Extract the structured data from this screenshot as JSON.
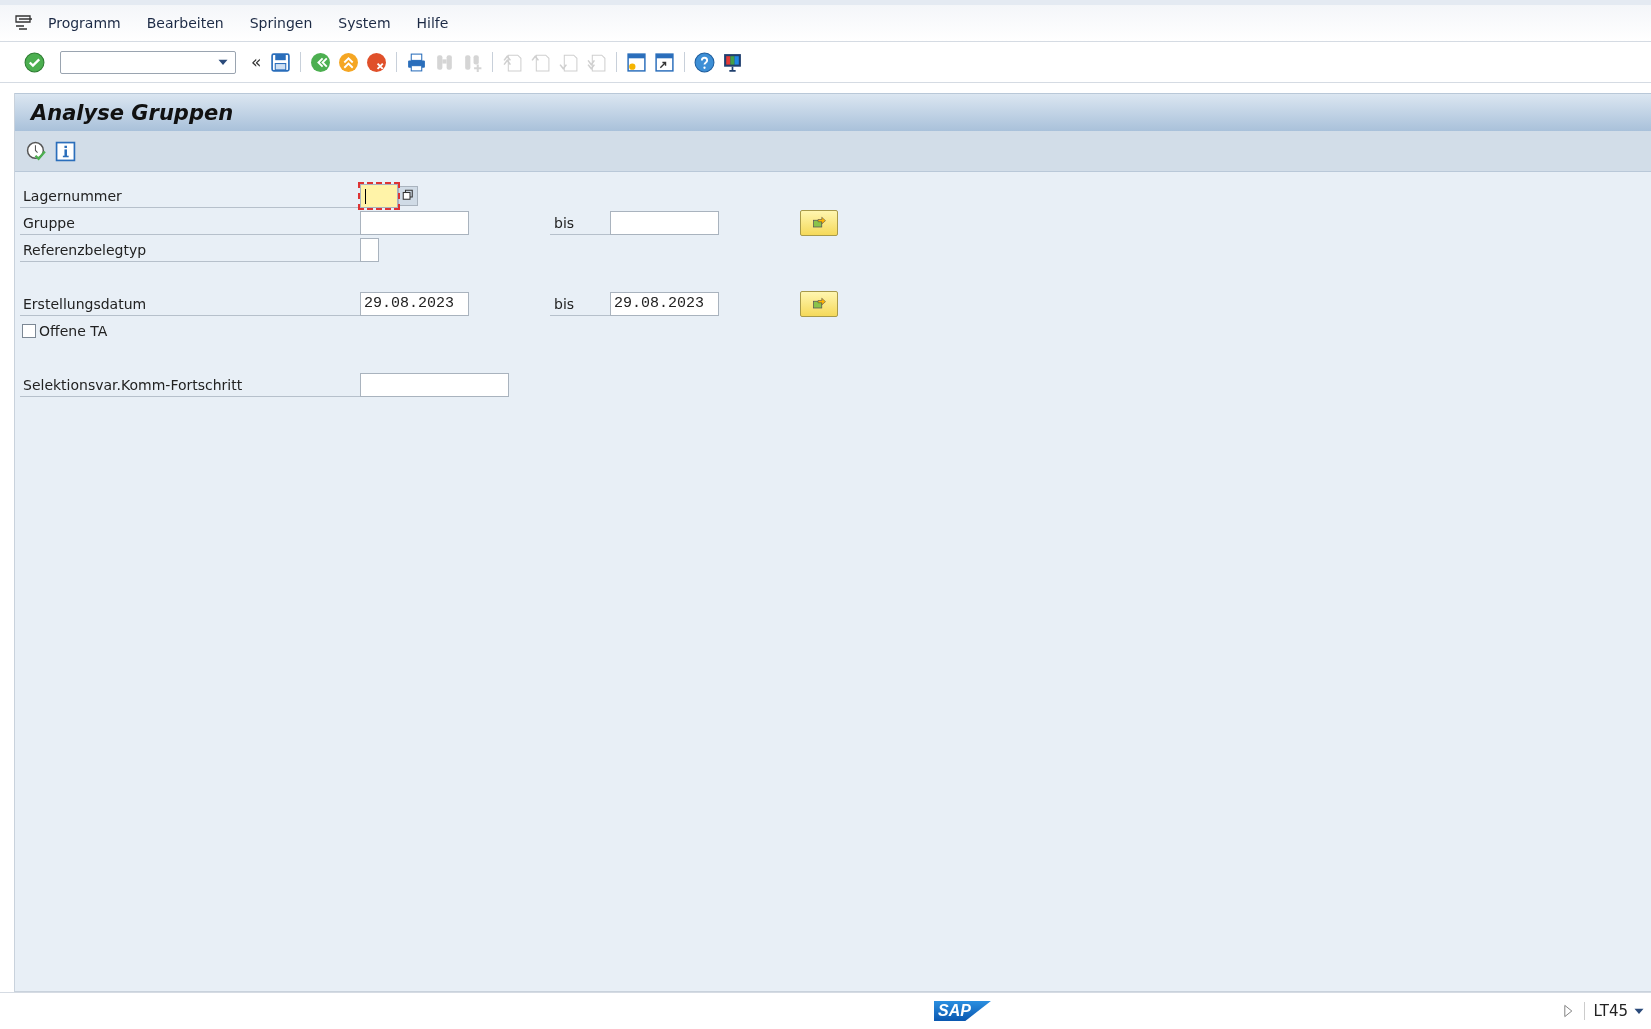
{
  "menu": [
    {
      "label": "Programm"
    },
    {
      "label": "Bearbeiten"
    },
    {
      "label": "Springen"
    },
    {
      "label": "System"
    },
    {
      "label": "Hilfe"
    }
  ],
  "toolbar": [
    {
      "kind": "enter",
      "disabled": false
    },
    {
      "kind": "command"
    },
    {
      "kind": "collapse",
      "text": "«"
    },
    {
      "kind": "save",
      "disabled": false
    },
    {
      "kind": "sep"
    },
    {
      "kind": "back",
      "disabled": false
    },
    {
      "kind": "exit",
      "disabled": false
    },
    {
      "kind": "cancel",
      "disabled": false
    },
    {
      "kind": "sep"
    },
    {
      "kind": "print",
      "disabled": false
    },
    {
      "kind": "find",
      "disabled": true
    },
    {
      "kind": "find-next",
      "disabled": true
    },
    {
      "kind": "sep"
    },
    {
      "kind": "first-page",
      "disabled": true
    },
    {
      "kind": "prev-page",
      "disabled": true
    },
    {
      "kind": "next-page",
      "disabled": true
    },
    {
      "kind": "last-page",
      "disabled": true
    },
    {
      "kind": "sep"
    },
    {
      "kind": "new-session",
      "disabled": false
    },
    {
      "kind": "shortcut",
      "disabled": false
    },
    {
      "kind": "sep"
    },
    {
      "kind": "help",
      "disabled": false
    },
    {
      "kind": "layout",
      "disabled": false
    }
  ],
  "title": "Analyse Gruppen",
  "app_toolbar": [
    {
      "kind": "execute"
    },
    {
      "kind": "info"
    }
  ],
  "form": [
    {
      "kind": "single",
      "label": "Lagernummer",
      "focused": true
    },
    {
      "kind": "range",
      "label": "Gruppe",
      "to_label": "bis"
    },
    {
      "kind": "short",
      "label": "Referenzbelegtyp"
    },
    {
      "kind": "spacer"
    },
    {
      "kind": "range",
      "label": "Erstellungsdatum",
      "value": "29.08.2023",
      "to_label": "bis",
      "to_value": "29.08.2023"
    },
    {
      "kind": "checkbox",
      "label": "Offene TA",
      "checked": false
    },
    {
      "kind": "spacer"
    },
    {
      "kind": "wide",
      "label": "Selektionsvar.Komm-Fortschritt"
    }
  ],
  "status_bar": {
    "logo": "SAP",
    "transaction": "LT45"
  }
}
